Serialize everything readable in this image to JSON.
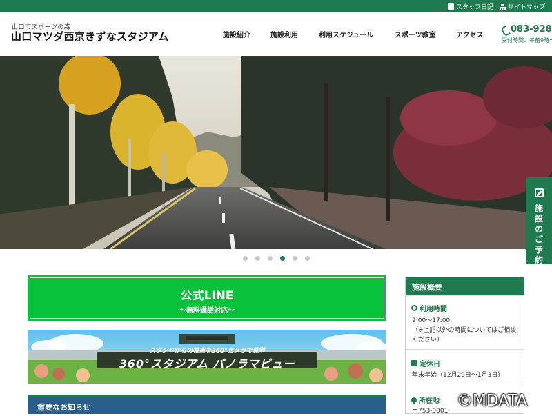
{
  "topbar": {
    "staff_diary": "スタッフ日記",
    "sitemap": "サイトマップ"
  },
  "header": {
    "logo_sub": "山口市スポーツの森",
    "logo_main": "山口マツダ西京きずなスタジアム",
    "nav": [
      "施設紹介",
      "施設利用",
      "利用スケジュール",
      "スポーツ教室",
      "アクセス"
    ],
    "phone": "083-928-",
    "hours": "受付時間：午前9時～"
  },
  "hero": {
    "slide_count": 6,
    "active_slide": 4
  },
  "side_tab": {
    "label": "施設のご予約"
  },
  "line_box": {
    "title": "公式LINE",
    "subtitle": "～無料通話対応～"
  },
  "banner": {
    "top_text": "スタンドからの視点を360°カメラで見学",
    "main_text": "360°スタジアム パノラマビュー"
  },
  "notice": {
    "title": "重要なお知らせ"
  },
  "facility": {
    "title": "施設概要",
    "sections": [
      {
        "title": "利用時間",
        "lines": [
          "9:00～17:00",
          "（※上記以外の時間についてはご相談ください）"
        ]
      },
      {
        "title": "定休日",
        "lines": [
          "年末年始（12月29日～1月3日）"
        ]
      },
      {
        "title": "所在地",
        "lines": [
          "〒753-0001"
        ]
      }
    ]
  },
  "watermark": "©MDATA",
  "colors": {
    "brand_green": "#1f7a4f",
    "line_green": "#06c139",
    "notice_blue": "#2a5f8a"
  }
}
